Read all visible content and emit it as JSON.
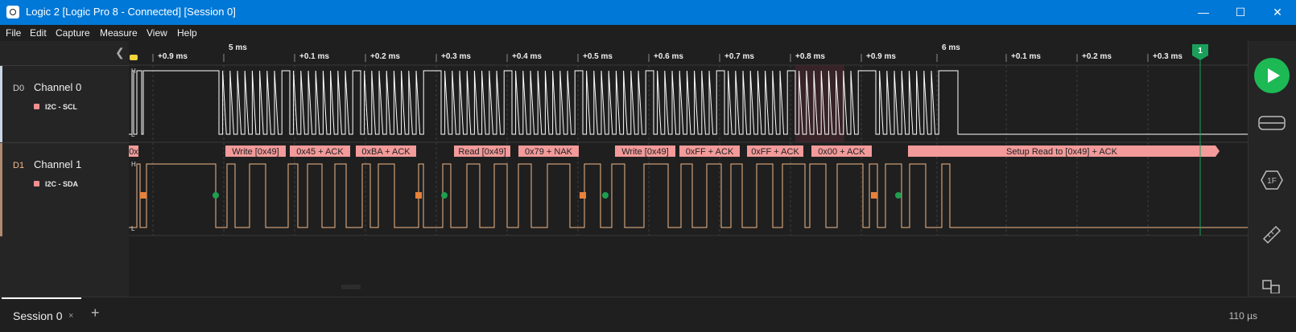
{
  "window": {
    "title": "Logic 2 [Logic Pro 8 - Connected] [Session 0]",
    "controls": {
      "minimize": "—",
      "maximize": "☐",
      "close": "✕"
    }
  },
  "menu": [
    "File",
    "Edit",
    "Capture",
    "Measure",
    "View",
    "Help"
  ],
  "timeline": {
    "labels": [
      "+0.9 ms",
      "5 ms",
      "+0.1 ms",
      "+0.2 ms",
      "+0.3 ms",
      "+0.4 ms",
      "+0.5 ms",
      "+0.6 ms",
      "+0.7 ms",
      "+0.8 ms",
      "+0.9 ms",
      "6 ms",
      "+0.1 ms",
      "+0.2 ms",
      "+0.3 ms"
    ],
    "marker": "1"
  },
  "channels": [
    {
      "code": "D0",
      "name": "Channel 0",
      "analyzer": "I2C - SCL",
      "color": "#ffffff"
    },
    {
      "code": "D1",
      "name": "Channel 1",
      "analyzer": "I2C - SDA",
      "color": "#f2b98a"
    }
  ],
  "levels": {
    "high": "H",
    "low": "L"
  },
  "decoded": [
    "0x",
    "Write [0x49]",
    "0x45 + ACK",
    "0xBA + ACK",
    "Read [0x49]",
    "0x79 + NAK",
    "Write [0x49]",
    "0xFF + ACK",
    "0xFF + ACK",
    "0x00 + ACK",
    "Setup Read to [0x49] + ACK"
  ],
  "colors": {
    "accent": "#0078d7",
    "play": "#1db954",
    "decode_bubble": "#f39a9a",
    "start_marker": "#e8823a",
    "stop_marker": "#1e9e4f"
  },
  "sidebar": {
    "icons": [
      "play-icon",
      "analyzers-icon",
      "extensions-icon",
      "measure-icon",
      "timing-markers-icon"
    ]
  },
  "session": {
    "tab": "Session 0",
    "close": "×",
    "add": "+"
  },
  "status": {
    "resolution": "110 µs"
  }
}
